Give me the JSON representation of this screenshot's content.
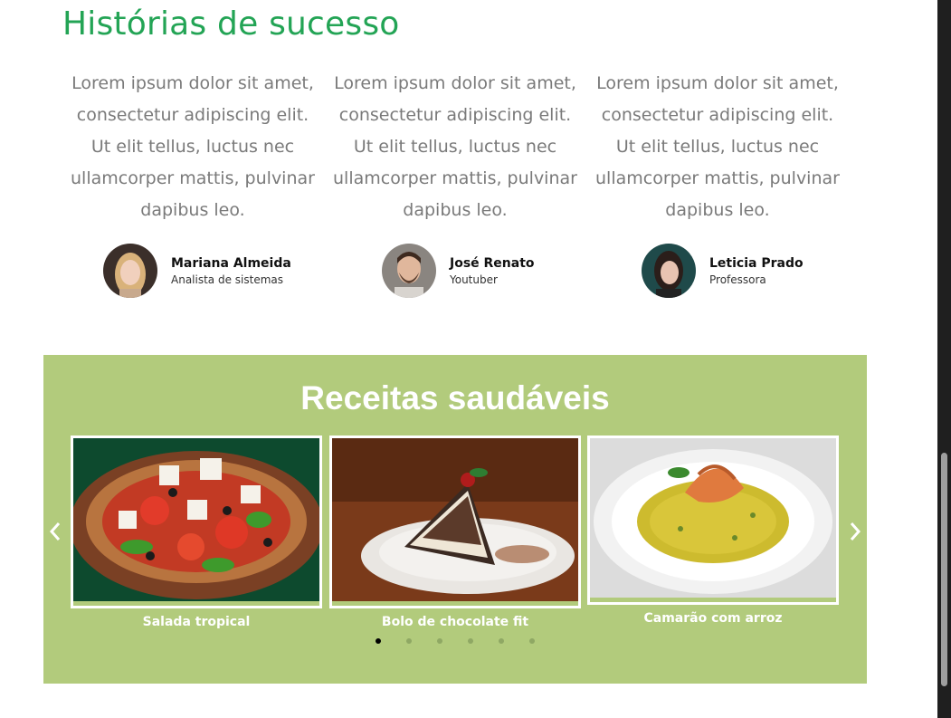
{
  "testimonials": {
    "title": "Histórias de sucesso",
    "items": [
      {
        "quote": "Lorem ipsum dolor sit amet, consectetur adipiscing elit. Ut elit tellus, luctus nec ullamcorper mattis, pulvinar dapibus leo.",
        "name": "Mariana Almeida",
        "role": "Analista de sistemas"
      },
      {
        "quote": "Lorem ipsum dolor sit amet, consectetur adipiscing elit. Ut elit tellus, luctus nec ullamcorper mattis, pulvinar dapibus leo.",
        "name": "José Renato",
        "role": "Youtuber"
      },
      {
        "quote": "Lorem ipsum dolor sit amet, consectetur adipiscing elit. Ut elit tellus, luctus nec ullamcorper mattis, pulvinar dapibus leo.",
        "name": "Leticia Prado",
        "role": "Professora"
      }
    ]
  },
  "recipes": {
    "title": "Receitas saudáveis",
    "items": [
      {
        "caption": "Salada tropical"
      },
      {
        "caption": "Bolo de chocolate fit"
      },
      {
        "caption": "Camarão com arroz"
      }
    ],
    "pagination": {
      "total": 6,
      "active": 1
    },
    "prev_icon": "chevron-left-icon",
    "next_icon": "chevron-right-icon"
  },
  "colors": {
    "heading_green": "#23a455",
    "recipes_bg": "#b2cb7c",
    "quote_text": "#7a7a7a"
  }
}
